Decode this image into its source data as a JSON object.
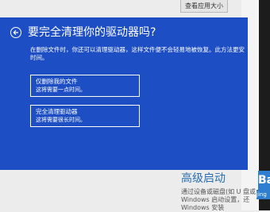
{
  "background": {
    "top_button": "查看应用大小",
    "heading": "高级启动",
    "lines": [
      "通过设备或磁盘(如 U 盘或",
      "Windows 启动设置，还",
      "Windows 安装"
    ],
    "watermark": "Ba",
    "watermark_sub": "jing"
  },
  "dialog": {
    "title": "要完全清理你的驱动器吗?",
    "description_lines": [
      "在删除文件时，你还可以清理驱动器，这样文件便不会轻易地被恢复。此方法更安",
      "时间。"
    ],
    "options": [
      {
        "title": "仅删除我的文件",
        "subtitle": "这将需要一点时间。"
      },
      {
        "title": "完全清理驱动器",
        "subtitle": "这将需要很长时间。"
      }
    ]
  },
  "colors": {
    "dialog_bg": "#1d4ec4",
    "text": "#ffffff",
    "accent": "#2a6fb2"
  },
  "icons": {
    "back": "back-arrow-icon"
  }
}
